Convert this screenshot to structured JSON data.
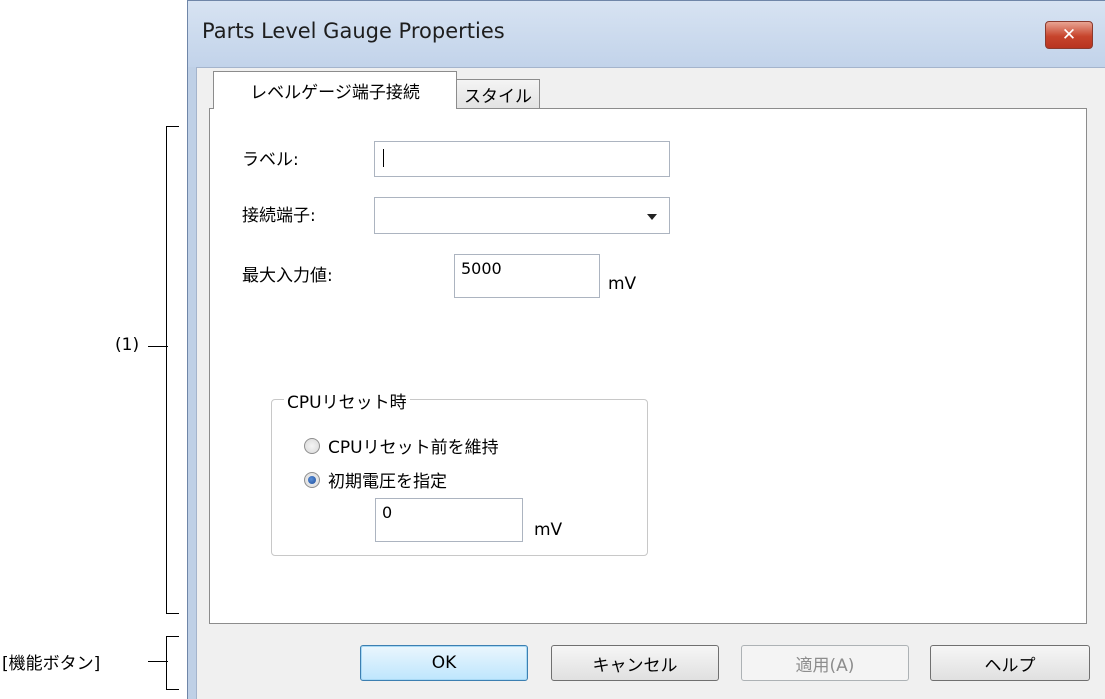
{
  "annotations": {
    "area_label": "(1)",
    "buttons_label": "[機能ボタン]"
  },
  "window": {
    "title": "Parts Level Gauge Properties",
    "close_icon": "close-icon"
  },
  "tabs": [
    {
      "label": "レベルゲージ端子接続",
      "active": true
    },
    {
      "label": "スタイル",
      "active": false
    }
  ],
  "form": {
    "label_caption": "ラベル:",
    "label_value": "",
    "terminal_caption": "接続端子:",
    "terminal_value": "",
    "max_input_caption": "最大入力値:",
    "max_input_value": "5000",
    "max_input_unit": "mV"
  },
  "cpu_reset": {
    "group_title": "CPUリセット時",
    "option_keep": "CPUリセット前を維持",
    "option_initial": "初期電圧を指定",
    "selected": "option_initial",
    "initial_value": "0",
    "initial_unit": "mV"
  },
  "buttons": {
    "ok": "OK",
    "cancel": "キャンセル",
    "apply": "適用(A)",
    "help": "ヘルプ"
  }
}
